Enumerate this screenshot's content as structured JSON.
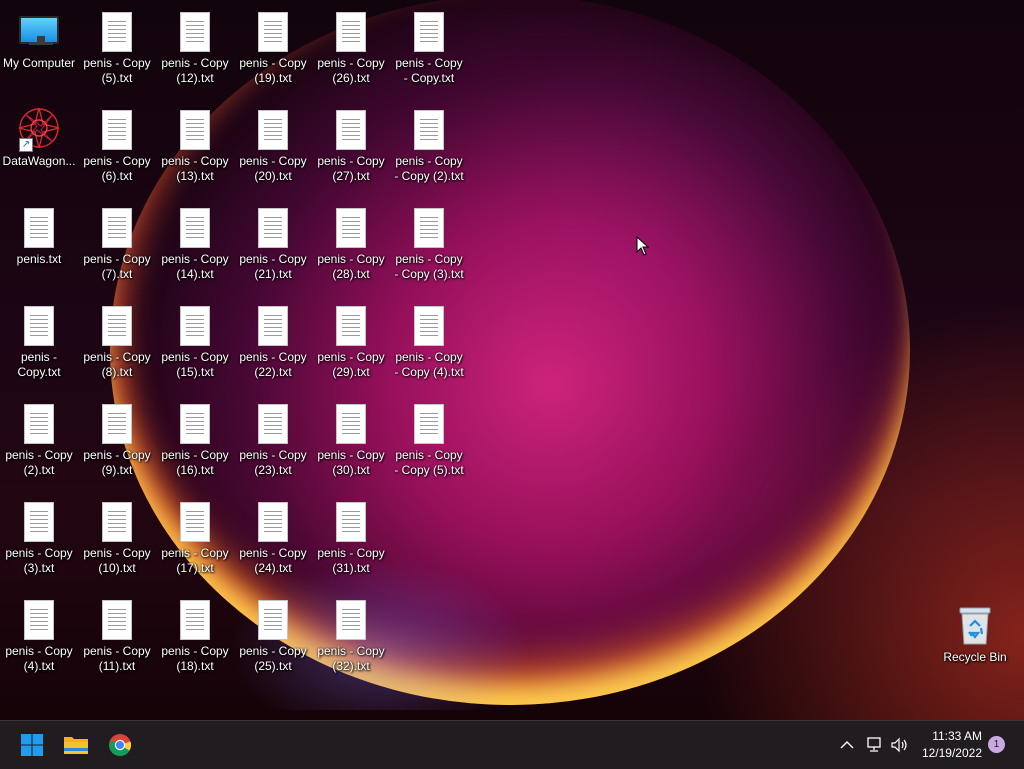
{
  "desktop": {
    "icons": [
      {
        "label": "My Computer",
        "type": "computer"
      },
      {
        "label": "DataWagon...",
        "type": "app"
      },
      {
        "label": "penis.txt",
        "type": "txt"
      },
      {
        "label": "penis -\nCopy.txt",
        "type": "txt"
      },
      {
        "label": "penis - Copy\n(2).txt",
        "type": "txt"
      },
      {
        "label": "penis - Copy\n(3).txt",
        "type": "txt"
      },
      {
        "label": "penis - Copy\n(4).txt",
        "type": "txt"
      },
      {
        "label": "penis - Copy\n(5).txt",
        "type": "txt"
      },
      {
        "label": "penis - Copy\n(6).txt",
        "type": "txt"
      },
      {
        "label": "penis - Copy\n(7).txt",
        "type": "txt"
      },
      {
        "label": "penis - Copy\n(8).txt",
        "type": "txt"
      },
      {
        "label": "penis - Copy\n(9).txt",
        "type": "txt"
      },
      {
        "label": "penis - Copy\n(10).txt",
        "type": "txt"
      },
      {
        "label": "penis - Copy\n(11).txt",
        "type": "txt"
      },
      {
        "label": "penis - Copy\n(12).txt",
        "type": "txt"
      },
      {
        "label": "penis - Copy\n(13).txt",
        "type": "txt"
      },
      {
        "label": "penis - Copy\n(14).txt",
        "type": "txt"
      },
      {
        "label": "penis - Copy\n(15).txt",
        "type": "txt"
      },
      {
        "label": "penis - Copy\n(16).txt",
        "type": "txt"
      },
      {
        "label": "penis - Copy\n(17).txt",
        "type": "txt"
      },
      {
        "label": "penis - Copy\n(18).txt",
        "type": "txt"
      },
      {
        "label": "penis - Copy\n(19).txt",
        "type": "txt"
      },
      {
        "label": "penis - Copy\n(20).txt",
        "type": "txt"
      },
      {
        "label": "penis - Copy\n(21).txt",
        "type": "txt"
      },
      {
        "label": "penis - Copy\n(22).txt",
        "type": "txt"
      },
      {
        "label": "penis - Copy\n(23).txt",
        "type": "txt"
      },
      {
        "label": "penis - Copy\n(24).txt",
        "type": "txt"
      },
      {
        "label": "penis - Copy\n(25).txt",
        "type": "txt"
      },
      {
        "label": "penis - Copy\n(26).txt",
        "type": "txt"
      },
      {
        "label": "penis - Copy\n(27).txt",
        "type": "txt"
      },
      {
        "label": "penis - Copy\n(28).txt",
        "type": "txt"
      },
      {
        "label": "penis - Copy\n(29).txt",
        "type": "txt"
      },
      {
        "label": "penis - Copy\n(30).txt",
        "type": "txt"
      },
      {
        "label": "penis - Copy\n(31).txt",
        "type": "txt"
      },
      {
        "label": "penis - Copy\n(32).txt",
        "type": "txt"
      },
      {
        "label": "penis - Copy\n- Copy.txt",
        "type": "txt"
      },
      {
        "label": "penis - Copy\n- Copy (2).txt",
        "type": "txt"
      },
      {
        "label": "penis - Copy\n- Copy (3).txt",
        "type": "txt"
      },
      {
        "label": "penis - Copy\n- Copy (4).txt",
        "type": "txt"
      },
      {
        "label": "penis - Copy\n- Copy (5).txt",
        "type": "txt"
      }
    ],
    "recycle_bin": {
      "label": "Recycle Bin",
      "icon": "recycle-bin-icon"
    }
  },
  "taskbar": {
    "pinned": [
      {
        "name": "start",
        "icon": "windows-logo-icon"
      },
      {
        "name": "file-explorer",
        "icon": "folder-icon"
      },
      {
        "name": "chrome",
        "icon": "chrome-icon"
      }
    ],
    "tray": {
      "overflow_icon": "chevron-up-icon",
      "network_icon": "network-icon",
      "volume_icon": "volume-icon",
      "time": "11:33 AM",
      "date": "12/19/2022",
      "notification_count": "1"
    }
  },
  "colors": {
    "taskbar_bg": "#201c1f",
    "win_blue": "#1e9cf0",
    "folder_yellow": "#f7c12b",
    "notification_badge": "#c9a9e0"
  }
}
